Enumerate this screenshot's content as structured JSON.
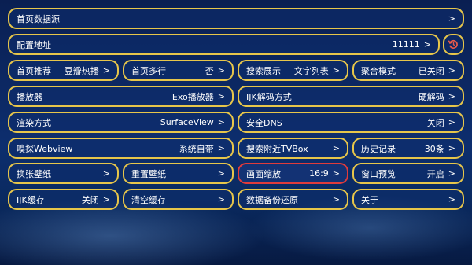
{
  "rows": {
    "home_source": {
      "label": "首页数据源",
      "value": "",
      "chevron": ">"
    },
    "config_url": {
      "label": "配置地址",
      "value": "11111",
      "chevron": ">"
    },
    "refresh_icon": "refresh-icon",
    "home_recommend": {
      "label": "首页推荐",
      "value": "豆瓣热播",
      "chevron": ">"
    },
    "home_multiline": {
      "label": "首页多行",
      "value": "否",
      "chevron": ">"
    },
    "search_display": {
      "label": "搜索展示",
      "value": "文字列表",
      "chevron": ">"
    },
    "aggregate_mode": {
      "label": "聚合模式",
      "value": "已关闭",
      "chevron": ">"
    },
    "player": {
      "label": "播放器",
      "value": "Exo播放器",
      "chevron": ">"
    },
    "ijk_decode": {
      "label": "IJK解码方式",
      "value": "硬解码",
      "chevron": ">"
    },
    "render_mode": {
      "label": "渲染方式",
      "value": "SurfaceView",
      "chevron": ">"
    },
    "secure_dns": {
      "label": "安全DNS",
      "value": "关闭",
      "chevron": ">"
    },
    "sniff_webview": {
      "label": "嗅探Webview",
      "value": "系统自带",
      "chevron": ">"
    },
    "search_tvbox": {
      "label": "搜索附近TVBox",
      "value": "",
      "chevron": ">"
    },
    "history": {
      "label": "历史记录",
      "value": "30条",
      "chevron": ">"
    },
    "change_wallpaper": {
      "label": "换张壁纸",
      "value": "",
      "chevron": ">"
    },
    "reset_wallpaper": {
      "label": "重置壁纸",
      "value": "",
      "chevron": ">"
    },
    "screen_scale": {
      "label": "画面缩放",
      "value": "16:9",
      "chevron": ">"
    },
    "window_preview": {
      "label": "窗口预览",
      "value": "开启",
      "chevron": ">"
    },
    "ijk_cache": {
      "label": "IJK缓存",
      "value": "关闭",
      "chevron": ">"
    },
    "clear_cache": {
      "label": "清空缓存",
      "value": "",
      "chevron": ">"
    },
    "backup_restore": {
      "label": "数据备份还原",
      "value": "",
      "chevron": ">"
    },
    "about": {
      "label": "关于",
      "value": "",
      "chevron": ">"
    }
  },
  "colors": {
    "border": "#e7c64a",
    "selected_border": "#e03b3b",
    "text": "#ffffff"
  }
}
